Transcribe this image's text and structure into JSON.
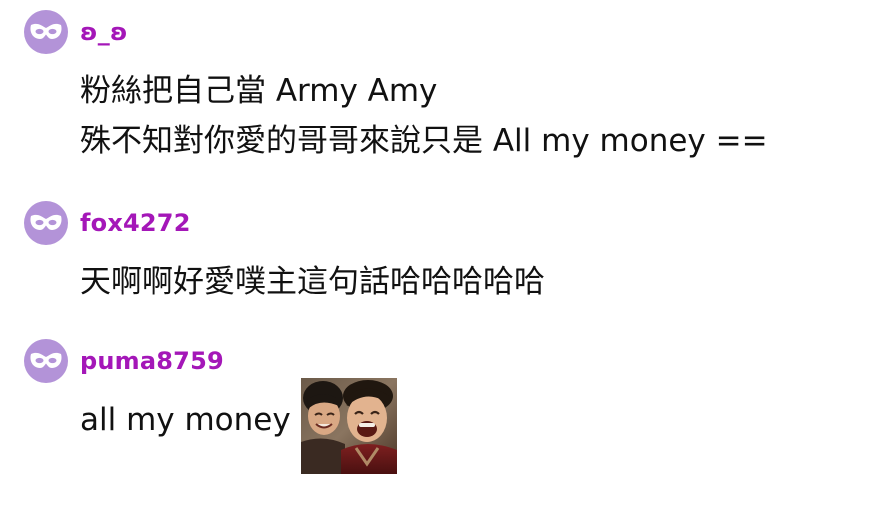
{
  "comments": [
    {
      "username": "ʚ_ʚ",
      "lines": [
        "粉絲把自己當 Army Amy",
        "殊不知對你愛的哥哥來說只是 All my money =="
      ],
      "avatar_icon": "mask-icon",
      "avatar_color": "#b393d8",
      "username_color": "#a417b8"
    },
    {
      "username": "fox4272",
      "lines": [
        "天啊啊好愛噗主這句話哈哈哈哈哈"
      ],
      "avatar_icon": "mask-icon",
      "avatar_color": "#b393d8",
      "username_color": "#a417b8"
    },
    {
      "username": "puma8759",
      "lines": [
        "all my money"
      ],
      "sticker_icon": "laughing-faces-sticker",
      "avatar_icon": "mask-icon",
      "avatar_color": "#b393d8",
      "username_color": "#a417b8"
    }
  ]
}
